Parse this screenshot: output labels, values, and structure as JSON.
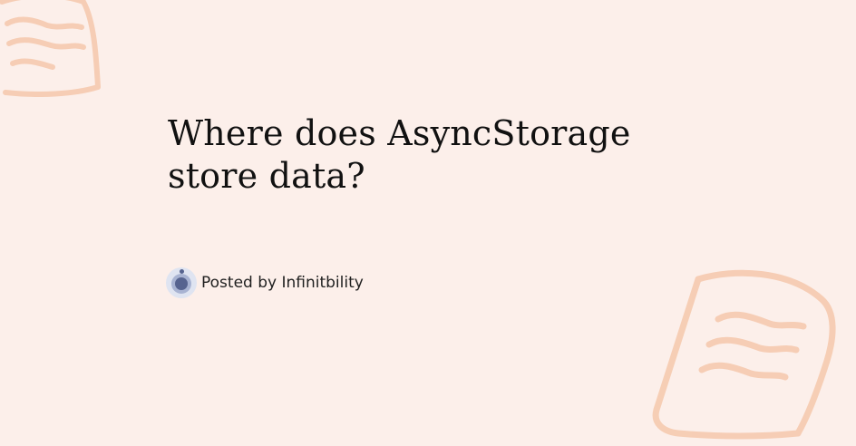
{
  "post": {
    "title": "Where does AsyncStorage store data?",
    "byline": "Posted by Infinitbility"
  },
  "colors": {
    "background": "#fcefea",
    "decoration": "#f5c8ac",
    "avatar_accent": "#56638f"
  },
  "icons": {
    "decoration_top_left": "note-doodle-icon",
    "decoration_bottom_right": "note-doodle-icon",
    "author_avatar": "user-avatar-icon"
  }
}
